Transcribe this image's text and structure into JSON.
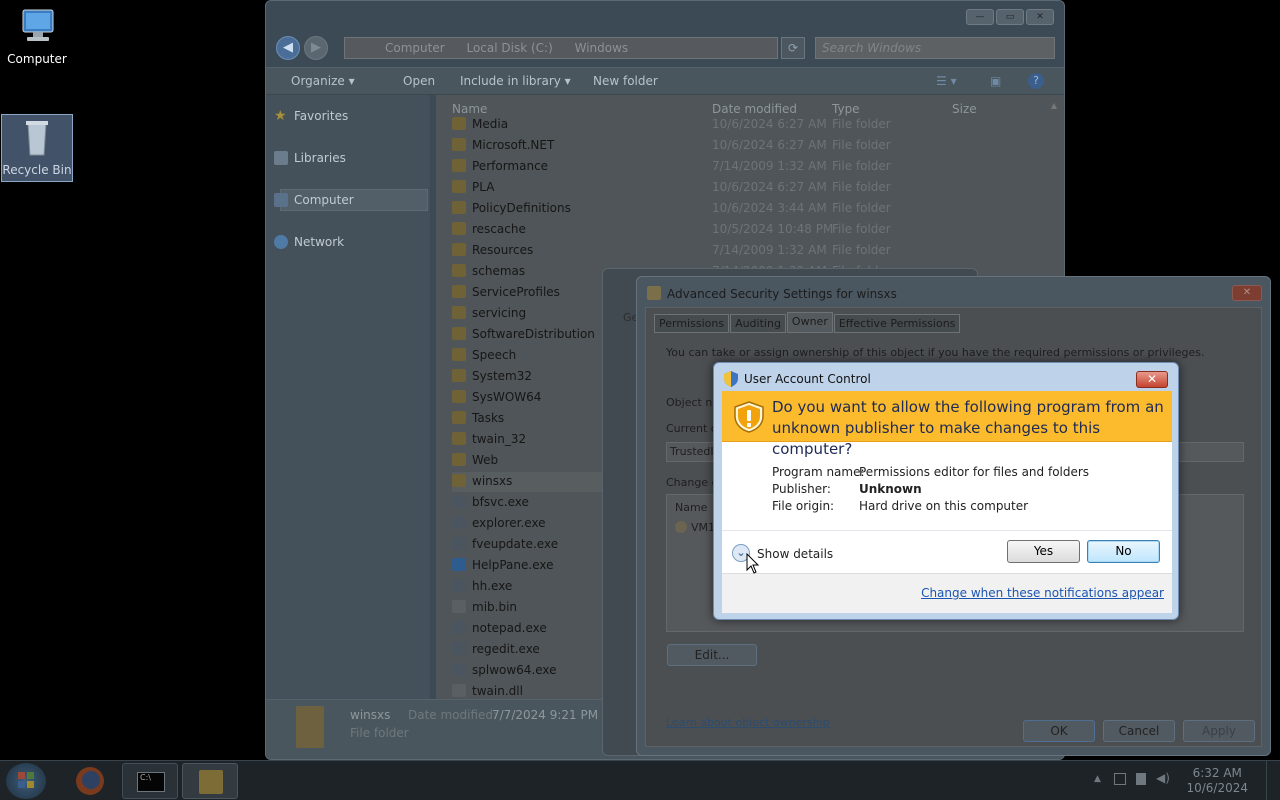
{
  "desktop": {
    "computer_label": "Computer",
    "recycle_label": "Recycle Bin"
  },
  "explorer": {
    "breadcrumb": [
      "Computer",
      "Local Disk (C:)",
      "Windows"
    ],
    "search_placeholder": "Search Windows",
    "toolbar": {
      "organize": "Organize ▾",
      "open": "Open",
      "include": "Include in library ▾",
      "new_folder": "New folder"
    },
    "nav": {
      "favorites": "Favorites",
      "libraries": "Libraries",
      "computer": "Computer",
      "network": "Network"
    },
    "columns": {
      "name": "Name",
      "date": "Date modified",
      "type": "Type",
      "size": "Size"
    },
    "rows": [
      {
        "name": "Media",
        "date": "10/6/2024 6:27 AM",
        "type": "File folder",
        "kind": "folder"
      },
      {
        "name": "Microsoft.NET",
        "date": "10/6/2024 6:27 AM",
        "type": "File folder",
        "kind": "folder"
      },
      {
        "name": "Performance",
        "date": "7/14/2009 1:32 AM",
        "type": "File folder",
        "kind": "folder"
      },
      {
        "name": "PLA",
        "date": "10/6/2024 6:27 AM",
        "type": "File folder",
        "kind": "folder"
      },
      {
        "name": "PolicyDefinitions",
        "date": "10/6/2024 3:44 AM",
        "type": "File folder",
        "kind": "folder"
      },
      {
        "name": "rescache",
        "date": "10/5/2024 10:48 PM",
        "type": "File folder",
        "kind": "folder"
      },
      {
        "name": "Resources",
        "date": "7/14/2009 1:32 AM",
        "type": "File folder",
        "kind": "folder"
      },
      {
        "name": "schemas",
        "date": "7/14/2009 1:32 AM",
        "type": "File folder",
        "kind": "folder"
      },
      {
        "name": "ServiceProfiles",
        "date": "",
        "type": "",
        "kind": "folder"
      },
      {
        "name": "servicing",
        "date": "",
        "type": "",
        "kind": "folder"
      },
      {
        "name": "SoftwareDistribution",
        "date": "",
        "type": "",
        "kind": "folder"
      },
      {
        "name": "Speech",
        "date": "",
        "type": "",
        "kind": "folder"
      },
      {
        "name": "System32",
        "date": "",
        "type": "",
        "kind": "folder"
      },
      {
        "name": "SysWOW64",
        "date": "",
        "type": "",
        "kind": "folder"
      },
      {
        "name": "Tasks",
        "date": "",
        "type": "",
        "kind": "folder"
      },
      {
        "name": "twain_32",
        "date": "",
        "type": "",
        "kind": "folder"
      },
      {
        "name": "Web",
        "date": "",
        "type": "",
        "kind": "folder"
      },
      {
        "name": "winsxs",
        "date": "",
        "type": "",
        "kind": "folder"
      },
      {
        "name": "bfsvc.exe",
        "date": "",
        "type": "",
        "kind": "exe"
      },
      {
        "name": "explorer.exe",
        "date": "",
        "type": "",
        "kind": "exe"
      },
      {
        "name": "fveupdate.exe",
        "date": "",
        "type": "",
        "kind": "exe"
      },
      {
        "name": "HelpPane.exe",
        "date": "",
        "type": "",
        "kind": "help"
      },
      {
        "name": "hh.exe",
        "date": "",
        "type": "",
        "kind": "exe"
      },
      {
        "name": "mib.bin",
        "date": "",
        "type": "",
        "kind": "file"
      },
      {
        "name": "notepad.exe",
        "date": "",
        "type": "",
        "kind": "exe"
      },
      {
        "name": "regedit.exe",
        "date": "",
        "type": "",
        "kind": "exe"
      },
      {
        "name": "splwow64.exe",
        "date": "",
        "type": "",
        "kind": "exe"
      },
      {
        "name": "twain.dll",
        "date": "",
        "type": "",
        "kind": "file"
      }
    ],
    "status": {
      "name": "winsxs",
      "date_label": "Date modified:",
      "date_value": "7/7/2024 9:21 PM",
      "type": "File folder"
    }
  },
  "properties": {
    "tab_fragment": "Ge"
  },
  "advanced": {
    "title": "Advanced Security Settings for winsxs",
    "tabs": [
      "Permissions",
      "Auditing",
      "Owner",
      "Effective Permissions"
    ],
    "active_tab": "Owner",
    "intro": "You can take or assign ownership of this object if you have the required permissions or privileges.",
    "object_name_label": "Object na",
    "current_owner_label": "Current ow",
    "current_owner_value": "TrustedIn",
    "change_owner_label": "Change ov",
    "list_header": "Name",
    "list_item": "VM1",
    "edit_button": "Edit...",
    "learn_link": "Learn about object ownership",
    "ok": "OK",
    "cancel": "Cancel",
    "apply": "Apply"
  },
  "uac": {
    "title": "User Account Control",
    "question": "Do you want to allow the following program from an unknown publisher to make changes to this computer?",
    "program_name_label": "Program name:",
    "program_name_value": "Permissions editor for files and folders",
    "publisher_label": "Publisher:",
    "publisher_value": "Unknown",
    "file_origin_label": "File origin:",
    "file_origin_value": "Hard drive on this computer",
    "show_details": "Show details",
    "yes": "Yes",
    "no": "No",
    "change_link": "Change when these notifications appear",
    "banner_color": "#fbbb2c"
  },
  "taskbar": {
    "time": "6:32 AM",
    "date": "10/6/2024"
  }
}
